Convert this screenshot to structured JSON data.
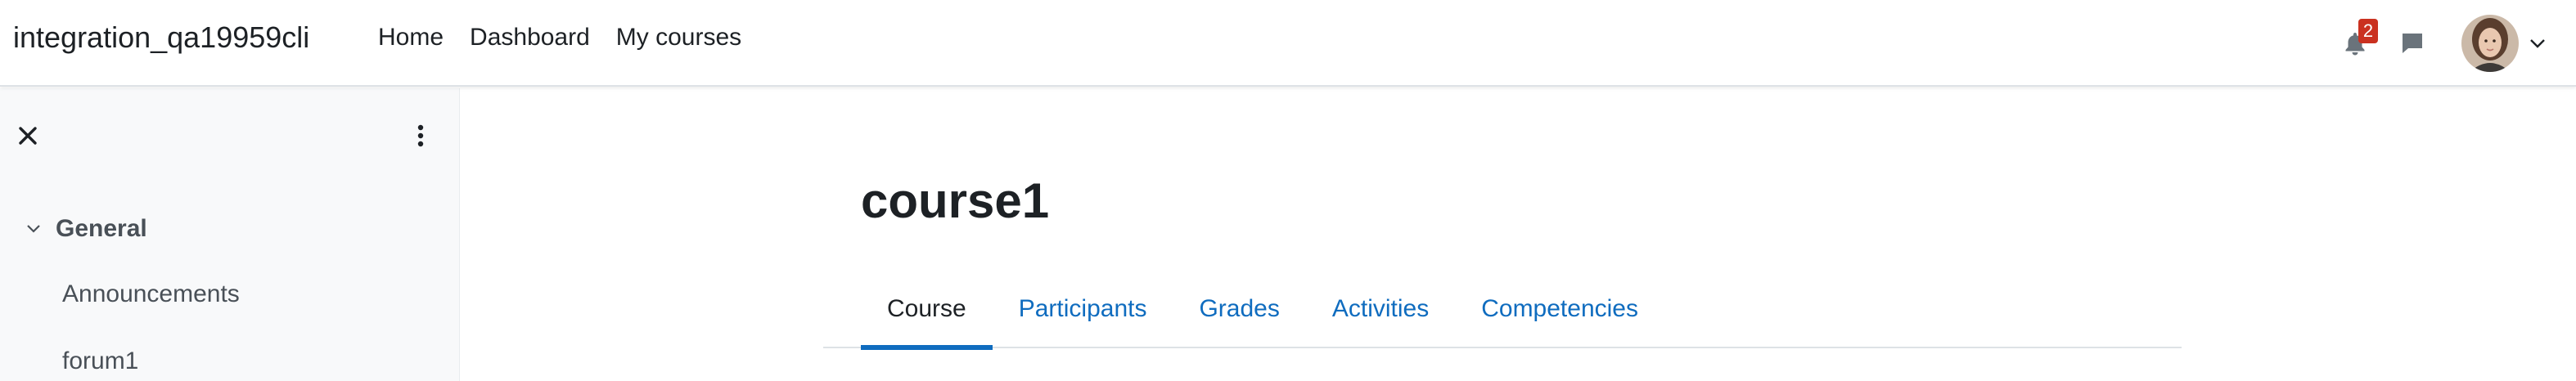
{
  "navbar": {
    "site_name": "integration_qa19959cli",
    "links": [
      {
        "label": "Home"
      },
      {
        "label": "Dashboard"
      },
      {
        "label": "My courses"
      }
    ],
    "notification_count": "2"
  },
  "drawer": {
    "section": {
      "title": "General",
      "items": [
        {
          "label": "Announcements"
        },
        {
          "label": "forum1"
        }
      ]
    }
  },
  "main": {
    "title": "course1",
    "tabs": [
      {
        "label": "Course",
        "active": true
      },
      {
        "label": "Participants",
        "active": false
      },
      {
        "label": "Grades",
        "active": false
      },
      {
        "label": "Activities",
        "active": false
      },
      {
        "label": "Competencies",
        "active": false
      }
    ]
  },
  "colors": {
    "link": "#0f6cbf",
    "badge": "#ca3120",
    "drawer_bg": "#f8f9fa",
    "text": "#1d2125"
  },
  "icons": {
    "notifications": "bell-icon",
    "messages": "chat-bubble-icon",
    "user_menu": "chevron-down-icon",
    "drawer_close": "close-icon",
    "drawer_menu": "kebab-menu-icon",
    "section_toggle": "chevron-down-icon"
  }
}
